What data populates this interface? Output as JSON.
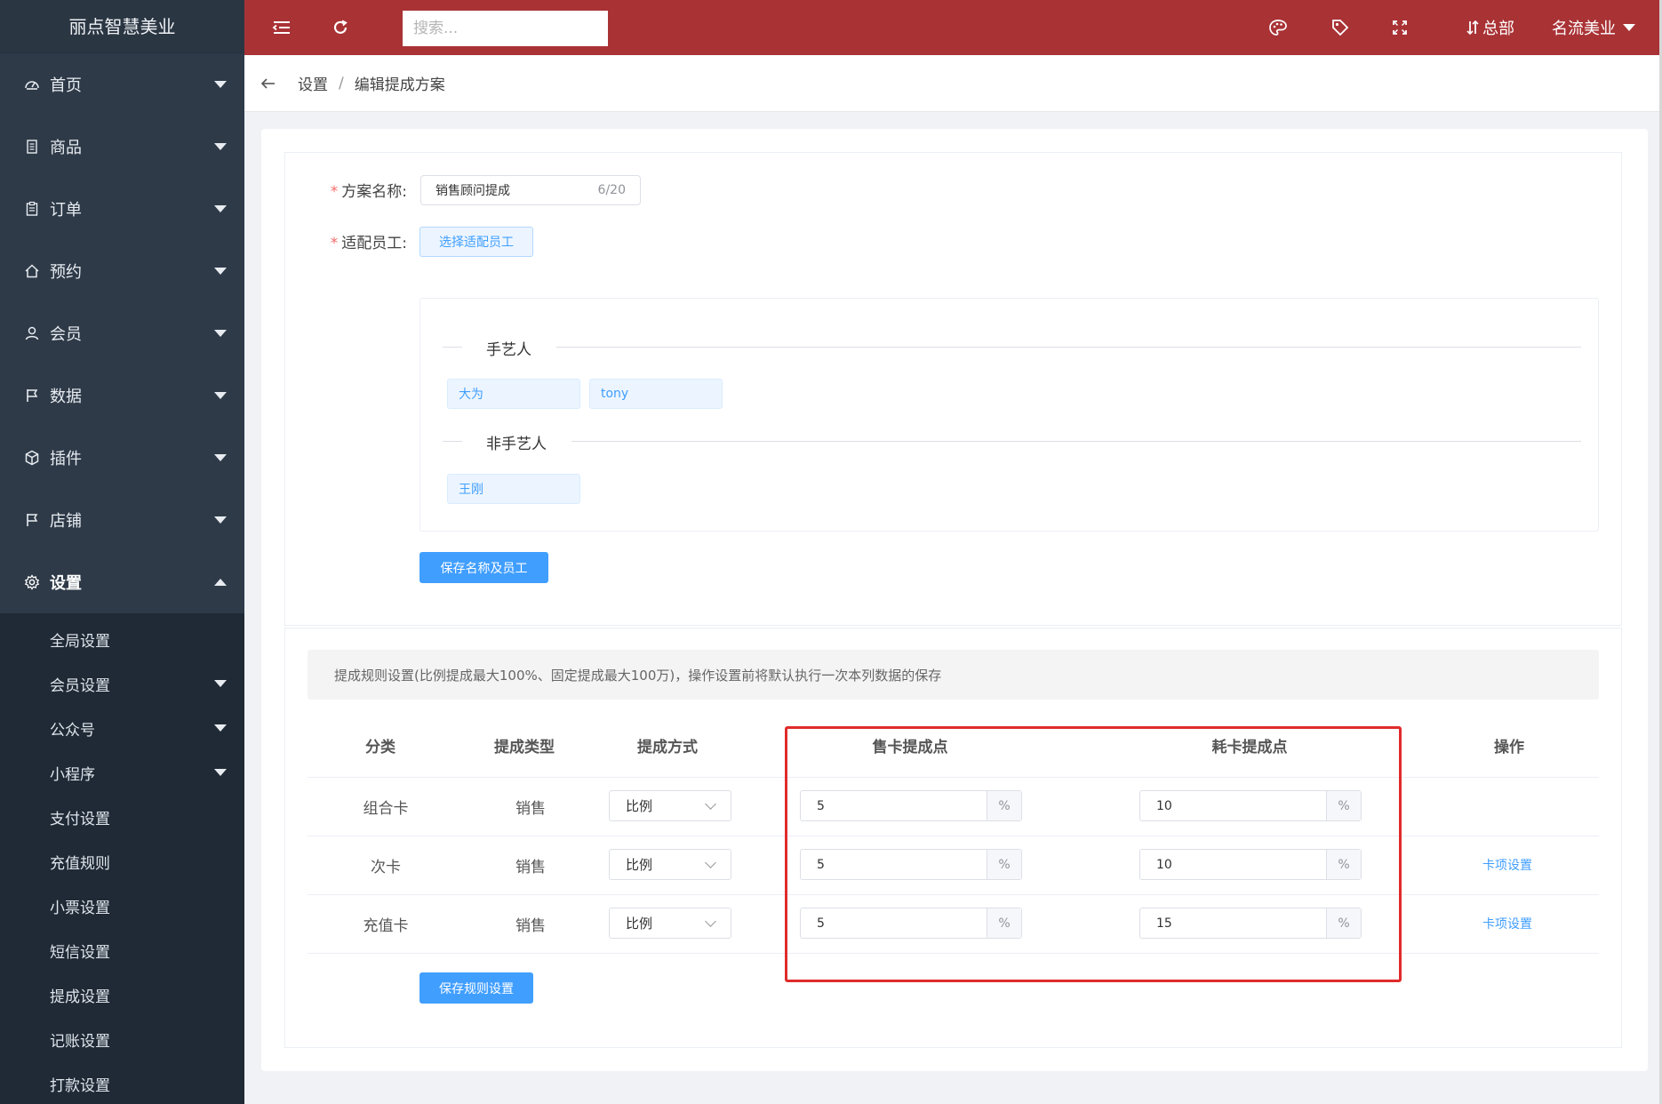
{
  "app": {
    "brand": "丽点智慧美业"
  },
  "topbar": {
    "search_placeholder": "搜索...",
    "branch_label": "总部",
    "account_label": "名流美业"
  },
  "sidebar": {
    "items": [
      {
        "label": "首页",
        "icon": "dashboard-icon",
        "expanded": false
      },
      {
        "label": "商品",
        "icon": "document-icon",
        "expanded": false
      },
      {
        "label": "订单",
        "icon": "clipboard-icon",
        "expanded": false
      },
      {
        "label": "预约",
        "icon": "home-icon",
        "expanded": false
      },
      {
        "label": "会员",
        "icon": "user-icon",
        "expanded": false
      },
      {
        "label": "数据",
        "icon": "flag-icon",
        "expanded": false
      },
      {
        "label": "插件",
        "icon": "box-icon",
        "expanded": false
      },
      {
        "label": "店铺",
        "icon": "flag-icon",
        "expanded": false
      },
      {
        "label": "设置",
        "icon": "gear-icon",
        "expanded": true
      }
    ],
    "settings_submenu": [
      {
        "label": "全局设置",
        "has_children": false
      },
      {
        "label": "会员设置",
        "has_children": true
      },
      {
        "label": "公众号",
        "has_children": true
      },
      {
        "label": "小程序",
        "has_children": true
      },
      {
        "label": "支付设置",
        "has_children": false
      },
      {
        "label": "充值规则",
        "has_children": false
      },
      {
        "label": "小票设置",
        "has_children": false
      },
      {
        "label": "短信设置",
        "has_children": false
      },
      {
        "label": "提成设置",
        "has_children": false
      },
      {
        "label": "记账设置",
        "has_children": false
      },
      {
        "label": "打款设置",
        "has_children": false
      }
    ]
  },
  "breadcrumb": {
    "parent": "设置",
    "separator": "/",
    "current": "编辑提成方案"
  },
  "form": {
    "name_label": "方案名称:",
    "name_value": "销售顾问提成",
    "name_count": "6/20",
    "staff_label": "适配员工:",
    "select_staff_button": "选择适配员工",
    "required_mark": "*"
  },
  "staff_groups": [
    {
      "title": "手艺人",
      "members": [
        "大为",
        "tony"
      ]
    },
    {
      "title": "非手艺人",
      "members": [
        "王刚"
      ]
    }
  ],
  "save_name_button": "保存名称及员工",
  "rules": {
    "notice": "提成规则设置(比例提成最大100%、固定提成最大100万)，操作设置前将默认执行一次本列数据的保存",
    "headers": {
      "category": "分类",
      "type": "提成类型",
      "method": "提成方式",
      "sell_point": "售卡提成点",
      "consume_point": "耗卡提成点",
      "action": "操作"
    },
    "unit": "%",
    "rows": [
      {
        "category": "组合卡",
        "type": "销售",
        "method": "比例",
        "sell": "5",
        "consume": "10",
        "action": ""
      },
      {
        "category": "次卡",
        "type": "销售",
        "method": "比例",
        "sell": "5",
        "consume": "10",
        "action": "卡项设置"
      },
      {
        "category": "充值卡",
        "type": "销售",
        "method": "比例",
        "sell": "5",
        "consume": "15",
        "action": "卡项设置"
      }
    ],
    "save_button": "保存规则设置"
  },
  "colors": {
    "topbar": "#a93235",
    "sidebar": "#2e3a48",
    "primary": "#409eff",
    "highlight": "#e02b2b"
  }
}
